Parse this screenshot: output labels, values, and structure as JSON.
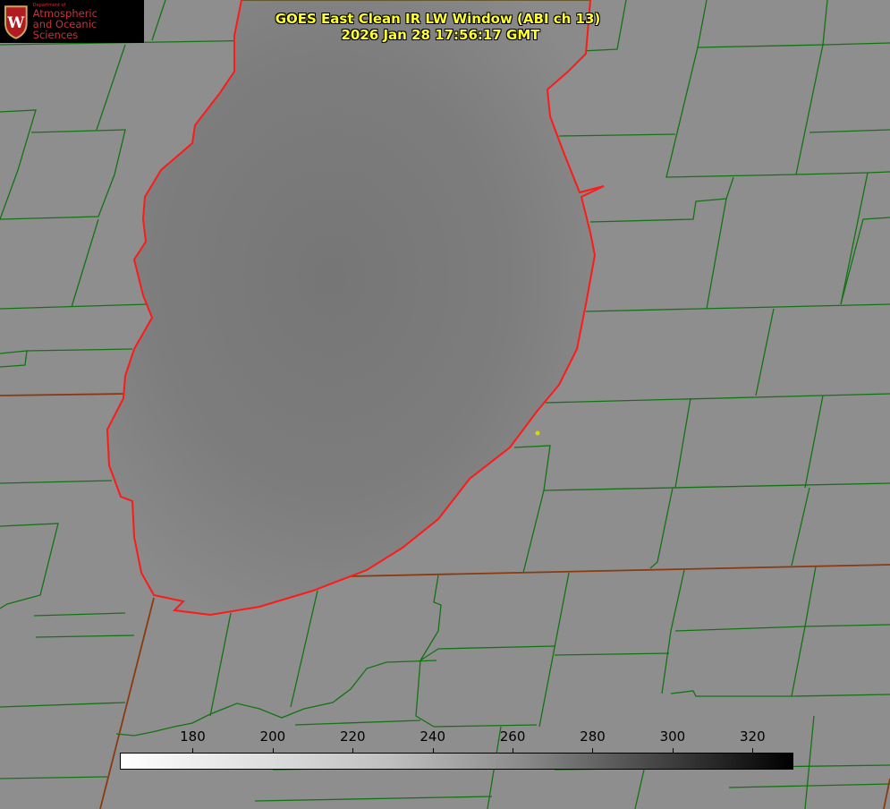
{
  "logo": {
    "dept": "Department of",
    "line1": "Atmospheric",
    "line2": "and Oceanic Sciences",
    "crest_letter": "W"
  },
  "title": {
    "line1": "GOES East Clean IR LW Window (ABI ch 13)",
    "line2": "2026 Jan 28 17:56:17 GMT"
  },
  "colorbar": {
    "min": 162,
    "max": 330,
    "ticks": [
      "180",
      "200",
      "220",
      "240",
      "260",
      "280",
      "300",
      "320"
    ],
    "tick_values": [
      180,
      200,
      220,
      240,
      260,
      280,
      300,
      320
    ]
  },
  "colors": {
    "county": "#137313",
    "state": "#8a3a10",
    "coast": "#ff1a1a",
    "marker": "#d8d800",
    "title": "#ffff30"
  }
}
